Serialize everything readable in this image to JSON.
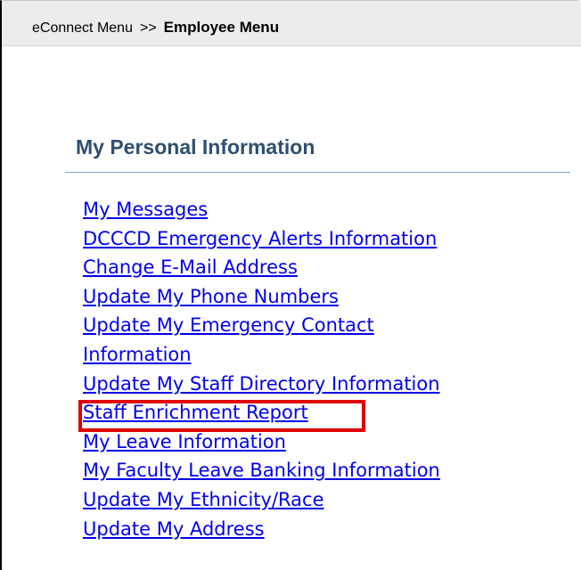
{
  "breadcrumb": {
    "root": "eConnect Menu",
    "separator": ">>",
    "current": "Employee Menu"
  },
  "section": {
    "title": "My Personal Information"
  },
  "links": [
    "My Messages",
    "DCCCD Emergency Alerts Information",
    "Change E-Mail Address",
    "Update My Phone Numbers",
    "Update My Emergency Contact",
    "Information",
    "Update My Staff Directory Information",
    "Staff Enrichment Report",
    "My Leave Information",
    "My Faculty Leave Banking Information",
    "Update My Ethnicity/Race",
    "Update My Address"
  ],
  "colors": {
    "link": "#0000ee",
    "section_title": "#2f4f6f",
    "highlight": "#e00000",
    "breadcrumb_bar": "#ececec"
  }
}
